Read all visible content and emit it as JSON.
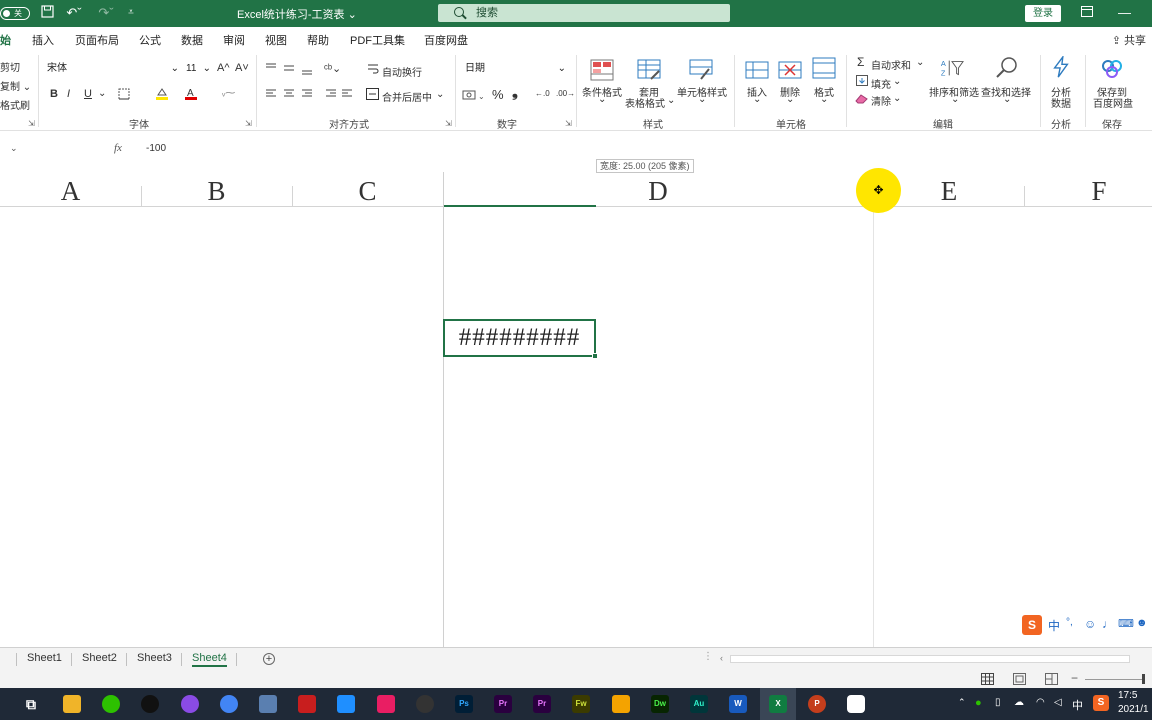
{
  "titlebar": {
    "autosave": "关",
    "title": "Excel统计练习-工资表 ⌄",
    "search": "搜索",
    "login": "登录"
  },
  "ribbon_tabs": [
    "始",
    "插入",
    "页面布局",
    "公式",
    "数据",
    "审阅",
    "视图",
    "帮助",
    "PDF工具集",
    "百度网盘"
  ],
  "share": "共享",
  "clipboard": {
    "cut": "剪切",
    "copy": "复制 ⌄",
    "painter": "格式刷"
  },
  "font": {
    "name": "宋体",
    "size": "11",
    "grow": "A^",
    "shrink": "A˅",
    "bold": "B",
    "italic": "I",
    "underline": "U",
    "label": "字体"
  },
  "alignment": {
    "wrap": "自动换行",
    "merge": "合并后居中",
    "label": "对齐方式"
  },
  "number": {
    "format": "日期",
    "percent": "%",
    "comma": "❟",
    "label": "数字"
  },
  "styles": {
    "conditional": "条件格式",
    "table_1": "套用",
    "table_2": "表格格式",
    "cell": "单元格样式",
    "label": "样式"
  },
  "cells": {
    "insert": "插入",
    "delete": "删除",
    "format": "格式",
    "label": "单元格"
  },
  "editing": {
    "autosum": "自动求和",
    "fill": "填充",
    "clear": "清除",
    "sort": "排序和筛选",
    "find": "查找和选择",
    "label": "编辑"
  },
  "analysis": {
    "btn_1": "分析",
    "btn_2": "数据",
    "label": "分析"
  },
  "save": {
    "btn_1": "保存到",
    "btn_2": "百度网盘",
    "label": "保存"
  },
  "formula_bar": {
    "fx": "fx",
    "value": "-100"
  },
  "tooltip": "宽度: 25.00 (205 像素)",
  "columns": [
    "A",
    "B",
    "C",
    "D",
    "E",
    "F"
  ],
  "selected_cell_display": "#########",
  "ime": {
    "logo": "S",
    "lang": "中"
  },
  "sheets": [
    "Sheet1",
    "Sheet2",
    "Sheet3",
    "Sheet4"
  ],
  "active_sheet": "Sheet4",
  "taskbar": {
    "apps": [
      "Ps",
      "Pr",
      "Pr",
      "Fw",
      "Dw",
      "Au",
      "W",
      "X",
      "P"
    ],
    "tray_lang": "中",
    "tray_ime": "S",
    "time": "17:5",
    "date": "2021/1"
  },
  "colors": {
    "excel_green": "#217346",
    "taskbar": "#1f2937",
    "cursor_highlight": "#ffe600"
  }
}
